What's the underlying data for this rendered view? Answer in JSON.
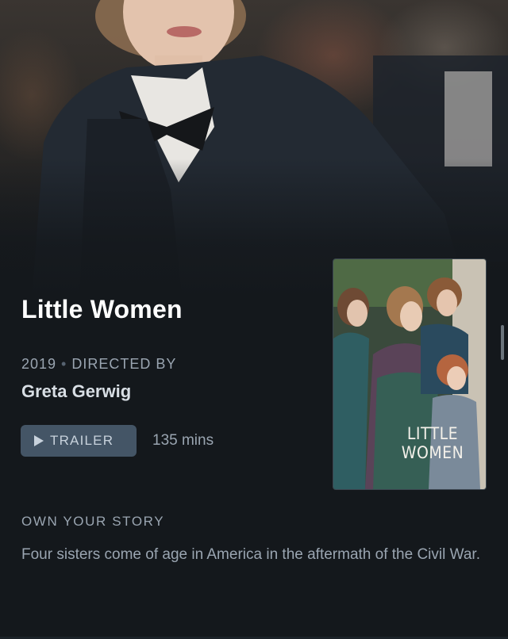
{
  "film": {
    "title": "Little Women",
    "year": "2019",
    "separator": "•",
    "directed_by_label": "DIRECTED BY",
    "director": "Greta Gerwig",
    "trailer_label": "TRAILER",
    "runtime": "135 mins",
    "tagline": "OWN YOUR STORY",
    "synopsis": "Four sisters come of age in America in the aftermath of the Civil War."
  },
  "poster": {
    "title_line1": "LITTLE",
    "title_line2": "WOMEN"
  },
  "icons": {
    "trailer": "play-icon"
  },
  "colors": {
    "background": "#14181c",
    "title": "#ffffff",
    "muted_text": "#9aa5b1",
    "button_bg": "#445566"
  }
}
